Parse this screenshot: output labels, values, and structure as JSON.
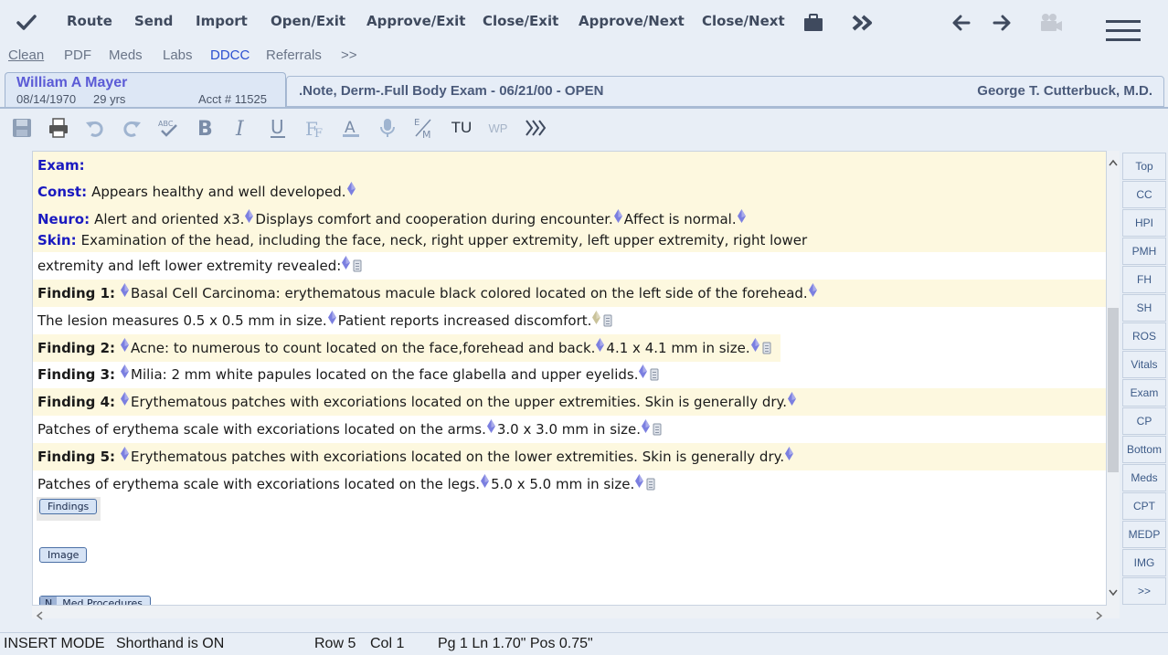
{
  "toolbar": {
    "route": "Route",
    "send": "Send",
    "import": "Import",
    "open_exit": "Open/Exit",
    "approve_exit": "Approve/Exit",
    "close_exit": "Close/Exit",
    "approve_next": "Approve/Next",
    "close_next": "Close/Next",
    "icons": [
      "checkmark-icon",
      "briefcase-icon",
      "fast-forward-icon",
      "back-arrow-icon",
      "forward-arrow-icon",
      "video-camera-icon",
      "hamburger-menu-icon"
    ]
  },
  "nav": {
    "clean": "Clean",
    "pdf": "PDF",
    "meds": "Meds",
    "labs": "Labs",
    "ddcc": "DDCC",
    "referrals": "Referrals",
    "more": ">>"
  },
  "patient": {
    "name": "William A Mayer",
    "dob": "08/14/1970",
    "age": "29 yrs",
    "acct": "Acct # 11525"
  },
  "note": {
    "title": ".Note, Derm-.Full Body Exam - 06/21/00 - OPEN",
    "provider": "George T. Cutterbuck, M.D."
  },
  "format_toolbar": {
    "tu": "TU",
    "wp": "WP",
    "icons": [
      "save-icon",
      "print-icon",
      "undo-icon",
      "redo-icon",
      "spellcheck-icon",
      "bold-icon",
      "italic-icon",
      "underline-icon",
      "font-icon",
      "font-color-icon",
      "microphone-icon",
      "em-icon",
      "chevrons-right-icon"
    ]
  },
  "editor": {
    "exam": "Exam:",
    "const_label": "Const:",
    "const_text": "Appears healthy and well developed.",
    "neuro_label": "Neuro:",
    "neuro_text1": "Alert and oriented x3.",
    "neuro_text2": "Displays comfort and cooperation during encounter.",
    "neuro_text3": "Affect is normal.",
    "skin_label": "Skin:",
    "skin_text1": "Examination of the head, including the face, neck, right upper extremity, left upper extremity, right lower",
    "skin_text2": "extremity and left lower extremity revealed:",
    "f1_label": "Finding 1:",
    "f1_text1": "Basal Cell Carcinoma: erythematous macule black colored located on the left side of the forehead.",
    "f1_text2": "The lesion measures 0.5 x 0.5 mm in size.",
    "f1_text3": "Patient reports increased discomfort.",
    "f2_label": "Finding 2:",
    "f2_text1": "Acne: to numerous to count located on the face,forehead and back.",
    "f2_text2": "4.1 x 4.1 mm in size.",
    "f3_label": "Finding 3:",
    "f3_text1": "Milia: 2 mm white papules located on the face glabella and upper eyelids.",
    "f4_label": "Finding 4:",
    "f4_text1": "Erythematous patches with excoriations located on the upper extremities. Skin is generally dry.",
    "f4_text2": "Patches of erythema scale with excoriations located on the arms.",
    "f4_text3": "3.0 x 3.0 mm in size.",
    "f5_label": "Finding 5:",
    "f5_text1": "Erythematous patches with excoriations located on the lower extremities. Skin is generally dry.",
    "f5_text2": "Patches of erythema scale with excoriations located on the legs.",
    "f5_text3": "5.0 x 5.0 mm in size.",
    "btn_findings": "Findings",
    "btn_image": "Image",
    "btn_n": "N",
    "btn_med_procedures": "Med Procedures"
  },
  "right_nav": [
    "Top",
    "CC",
    "HPI",
    "PMH",
    "FH",
    "SH",
    "ROS",
    "Vitals",
    "Exam",
    "CP",
    "Bottom",
    "Meds",
    "CPT",
    "MEDP",
    "IMG",
    ">>"
  ],
  "status": {
    "mode": "INSERT MODE",
    "shorthand": "Shorthand is ON",
    "row": "Row 5",
    "col": "Col 1",
    "position": "Pg 1 Ln 1.70\" Pos 0.75\""
  },
  "colors": {
    "accent_blue": "#1a1ac0",
    "diamond": "#7b7fe0",
    "highlight": "#fdf8df"
  }
}
